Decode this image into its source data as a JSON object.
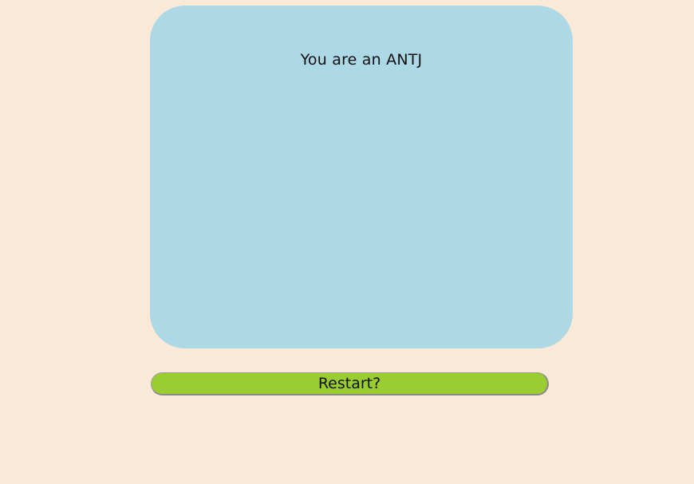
{
  "result": {
    "text": "You are an ANTJ"
  },
  "actions": {
    "restart_label": "Restart?"
  },
  "colors": {
    "background": "#fae9d7",
    "card": "#add8e6",
    "button": "#9acd32"
  }
}
